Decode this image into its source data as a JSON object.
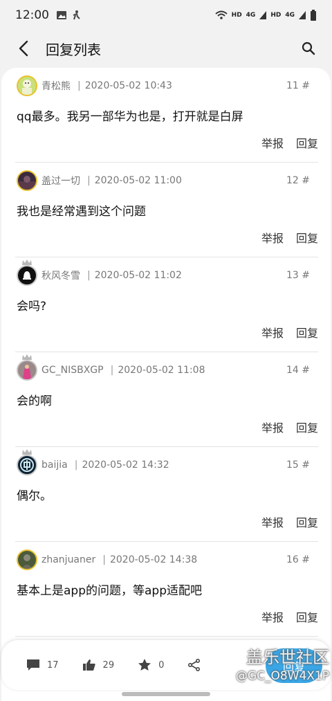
{
  "status_bar": {
    "time": "12:00",
    "network_labels": [
      "HD",
      "4G",
      "HD",
      "4G"
    ],
    "icons": [
      "image-icon",
      "accessibility-icon",
      "wifi-icon",
      "signal-icon",
      "signal-icon",
      "battery-icon"
    ]
  },
  "app_bar": {
    "title": "回复列表",
    "back_icon": "chevron-left-icon",
    "search_icon": "search-icon"
  },
  "replies": [
    {
      "username": "青松熊",
      "date": "2020-05-02 10:43",
      "floor": "11 #",
      "content": "qq最多。我另一部华为也是，打开就是白屏",
      "report": "举报",
      "reply": "回复",
      "avatar_color": "#c9e07a",
      "crown": false
    },
    {
      "username": "盖过一切",
      "date": "2020-05-02 11:00",
      "floor": "12 #",
      "content": "我也是经常遇到这个问题",
      "report": "举报",
      "reply": "回复",
      "avatar_color": "#3a2a3e",
      "crown": false
    },
    {
      "username": "秋风冬雪",
      "date": "2020-05-02 11:02",
      "floor": "13 #",
      "content": "会吗?",
      "report": "举报",
      "reply": "回复",
      "avatar_color": "#111111",
      "crown": true
    },
    {
      "username": "GC_NISBXGP",
      "date": "2020-05-02 11:08",
      "floor": "14 #",
      "content": "会的啊",
      "report": "举报",
      "reply": "回复",
      "avatar_color": "#d9649e",
      "crown": true
    },
    {
      "username": "baijia",
      "date": "2020-05-02 14:32",
      "floor": "15 #",
      "content": "偶尔。",
      "report": "举报",
      "reply": "回复",
      "avatar_color": "#0b2233",
      "crown": true
    },
    {
      "username": "zhanjuaner",
      "date": "2020-05-02 14:38",
      "floor": "16 #",
      "content": "基本上是app的问题，等app适配吧",
      "report": "举报",
      "reply": "回复",
      "avatar_color": "#4b5a3a",
      "crown": false
    }
  ],
  "bottom_bar": {
    "comments": "17",
    "likes": "29",
    "favorites": "0",
    "reply_button": "回复"
  },
  "watermark": {
    "line1": "盖乐世社区",
    "line2": "@GC_O8W4X1P"
  },
  "colors": {
    "accent": "#3aa6e6",
    "background": "#f2f2f2",
    "card": "#ffffff",
    "avatar_ring_gold": "#e8c230"
  }
}
